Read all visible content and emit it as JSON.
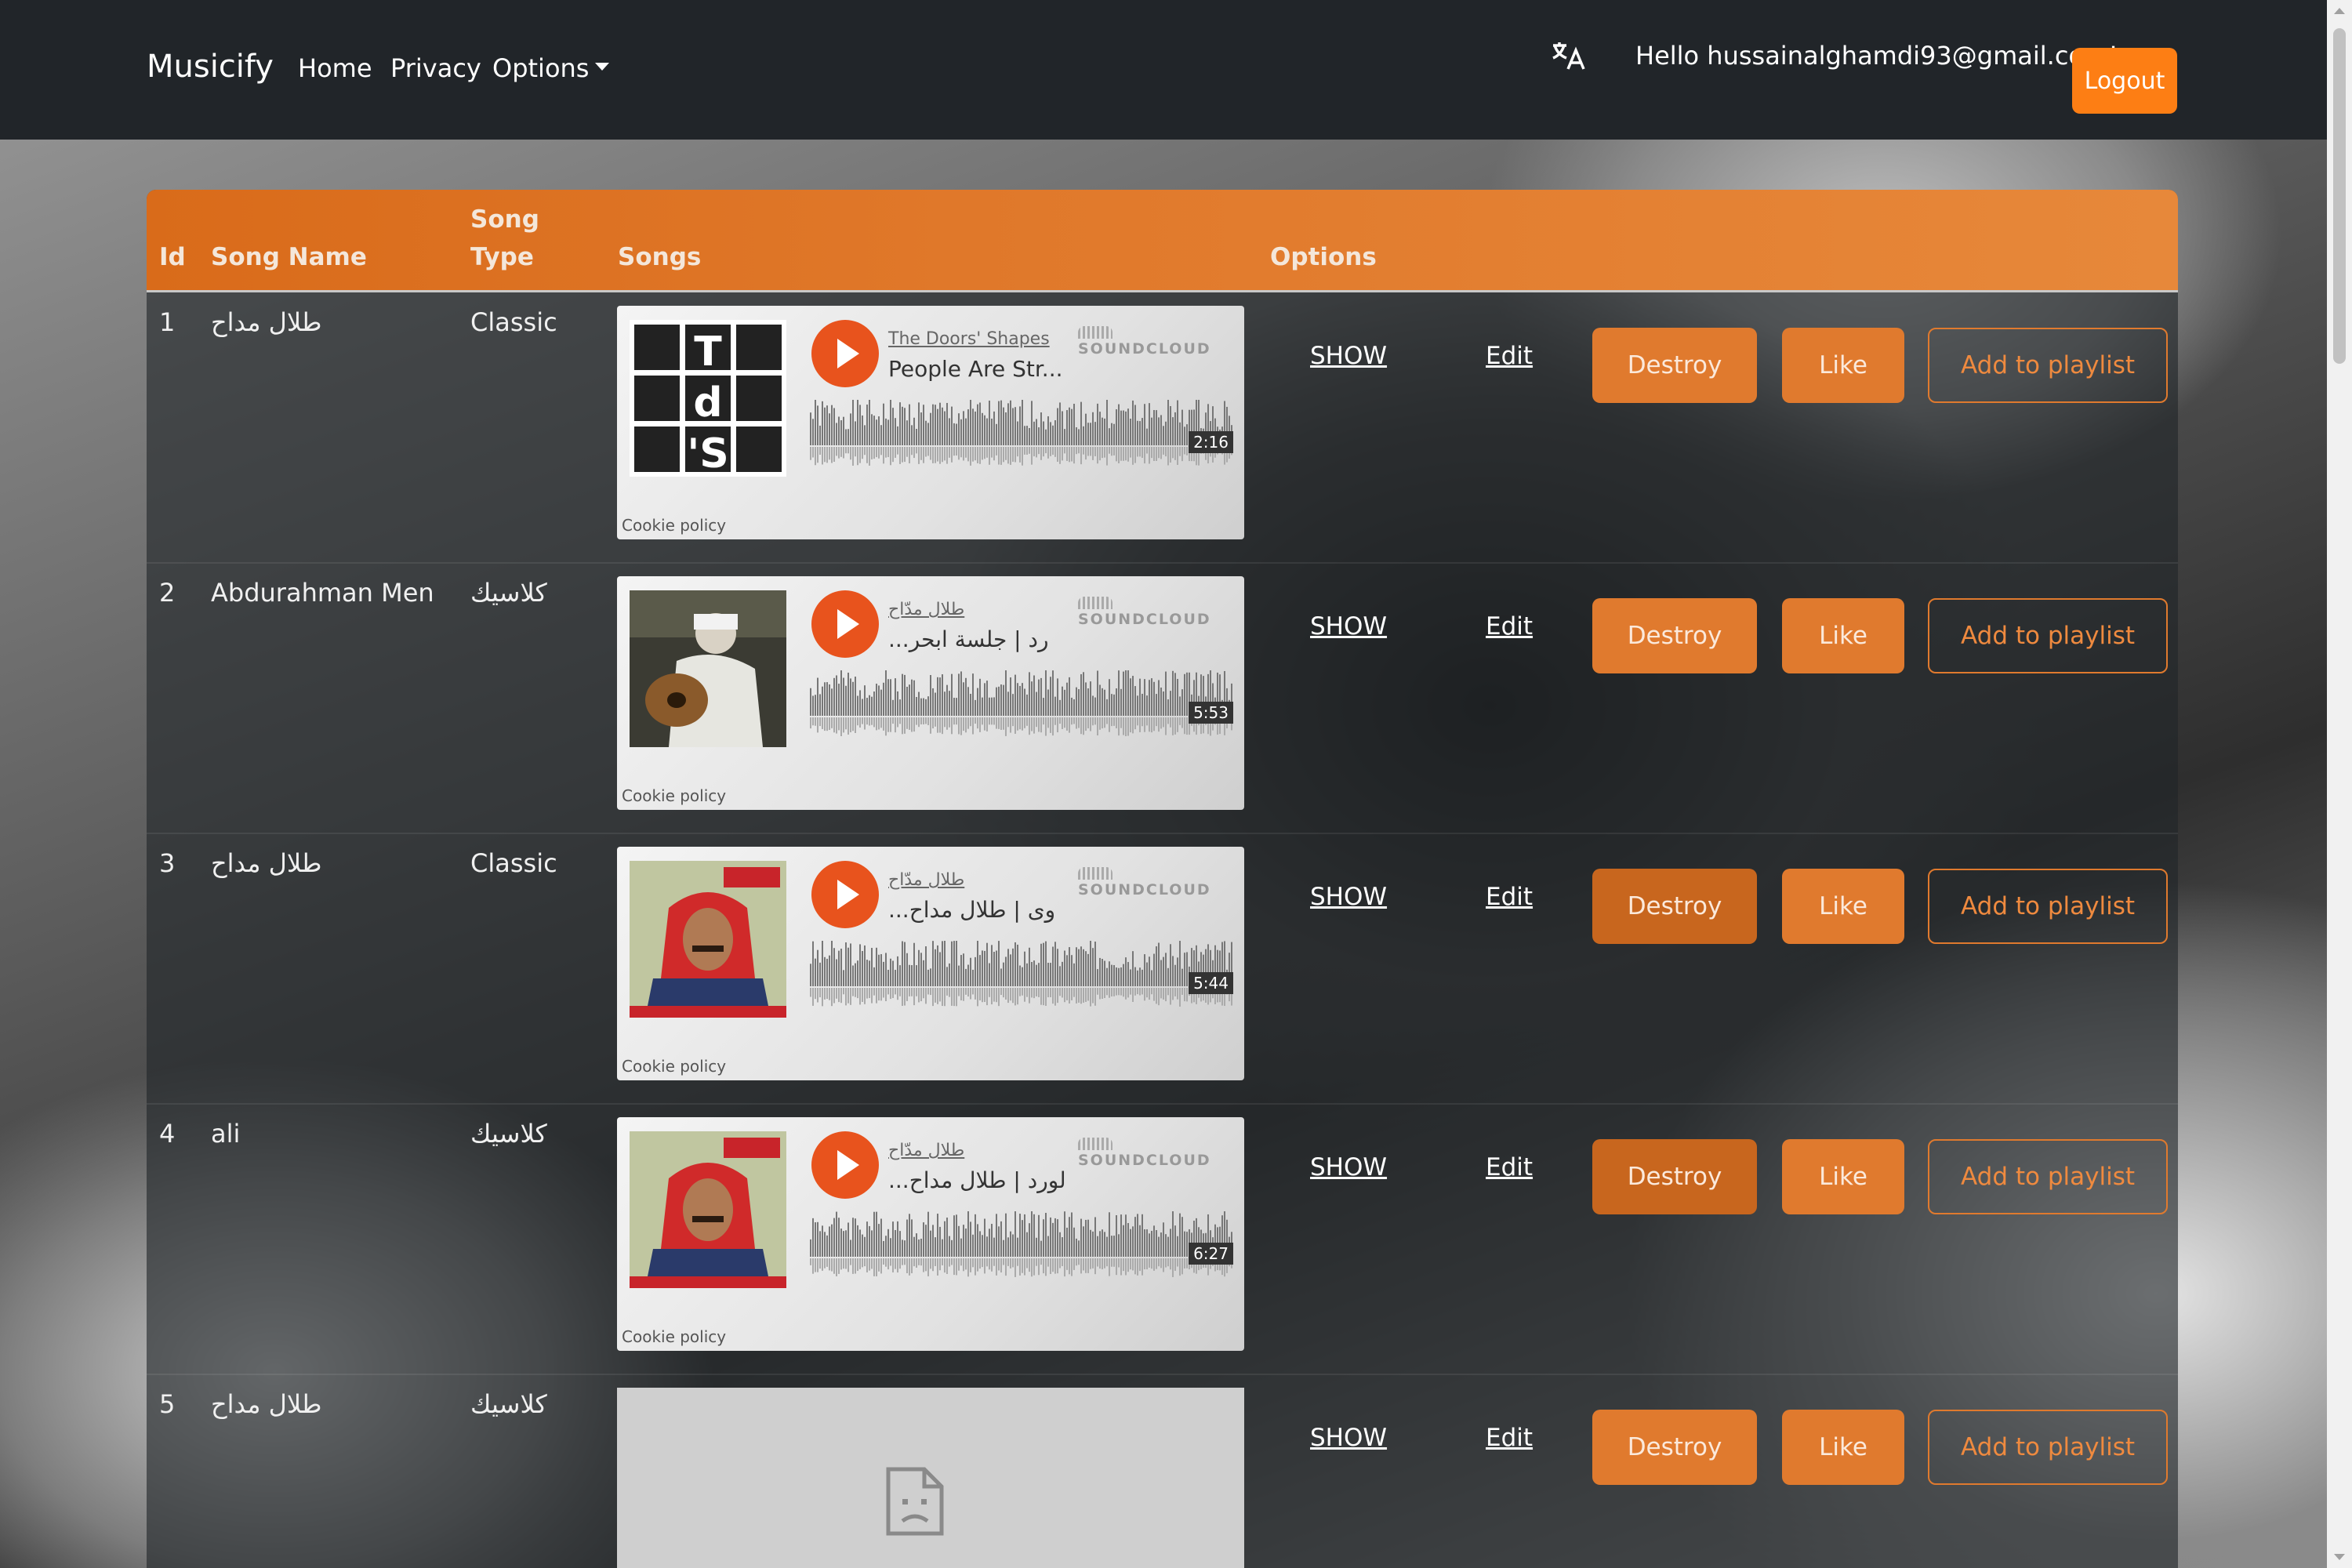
{
  "navbar": {
    "brand": "Musicify",
    "links": [
      "Home",
      "Privacy",
      "Options"
    ],
    "greeting": "Hello hussainalghamdi93@gmail.com!",
    "logout_label": "Logout"
  },
  "table": {
    "headers": {
      "id": "Id",
      "song_name": "Song Name",
      "song_type_1": "Song",
      "song_type_2": "Type",
      "songs": "Songs",
      "options": "Options"
    },
    "action_labels": {
      "show": "SHOW",
      "edit": "Edit",
      "destroy": "Destroy",
      "like": "Like",
      "add_to_playlist": "Add to playlist"
    },
    "rows": [
      {
        "id": "1",
        "name": "طلال مداح",
        "type": "Classic",
        "player": {
          "artist": "The Doors' Shapes",
          "title": "People Are Str...",
          "duration": "2:16",
          "brand": "SOUNDCLOUD",
          "cookie": "Cookie policy",
          "art": "tds-logo"
        }
      },
      {
        "id": "2",
        "name": "Abdurahman Men",
        "type": "كلاسيك",
        "player": {
          "artist": "طلال مدّاح",
          "title": "...رد | جلسة ابحر",
          "duration": "5:53",
          "brand": "SOUNDCLOUD",
          "cookie": "Cookie policy",
          "art": "oud-player-photo"
        }
      },
      {
        "id": "3",
        "name": "طلال مداح",
        "type": "Classic",
        "player": {
          "artist": "طلال مدّاح",
          "title": "...وى | طلال مداح",
          "duration": "5:44",
          "brand": "SOUNDCLOUD",
          "cookie": "Cookie policy",
          "art": "album-cover-red-scarf"
        }
      },
      {
        "id": "4",
        "name": "ali",
        "type": "كلاسيك",
        "player": {
          "artist": "طلال مدّاح",
          "title": "...لورد | طلال مداح",
          "duration": "6:27",
          "brand": "SOUNDCLOUD",
          "cookie": "Cookie policy",
          "art": "album-cover-red-scarf"
        }
      },
      {
        "id": "5",
        "name": "طلال مداح",
        "type": "كلاسيك",
        "player": null
      }
    ]
  },
  "colors": {
    "accent": "#e07a2e",
    "navbar": "#212529",
    "soundcloud_play": "#e8531d"
  },
  "icons": {
    "language": "translate-icon",
    "dropdown": "chevron-down-icon",
    "broken_embed": "sad-file-icon"
  }
}
